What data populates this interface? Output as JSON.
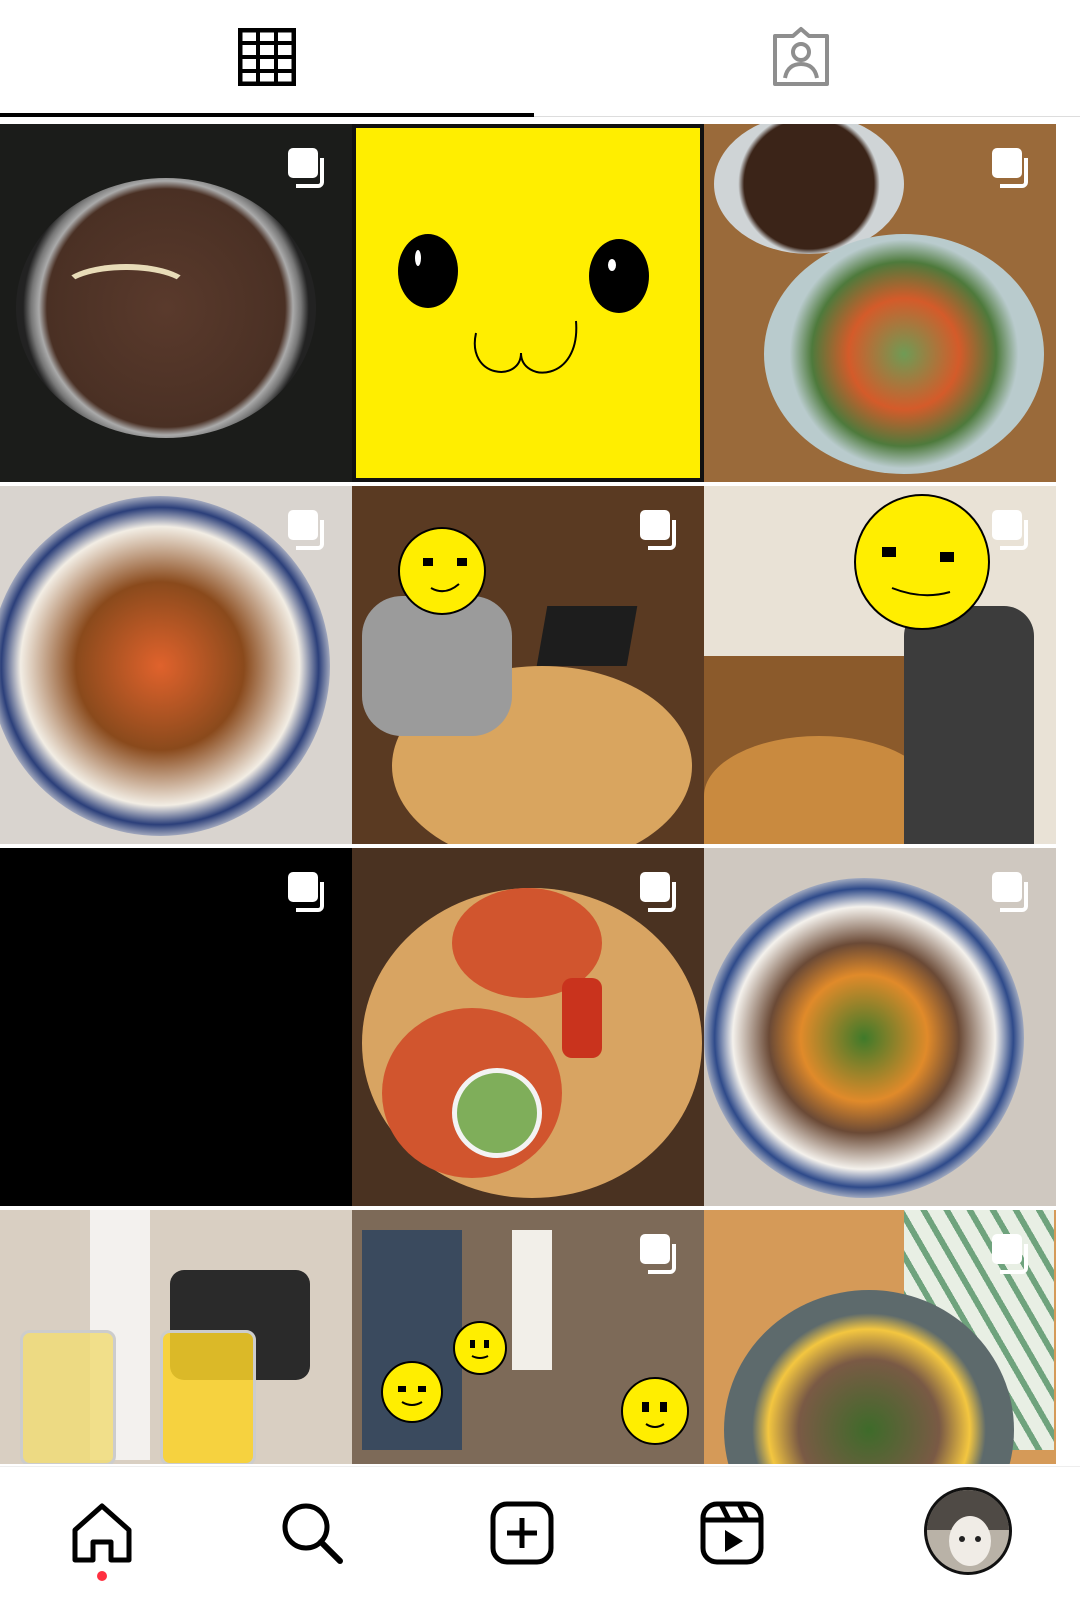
{
  "tabs": [
    {
      "name": "grid",
      "icon": "grid-icon",
      "active": true
    },
    {
      "name": "tagged",
      "icon": "tagged-person-icon",
      "active": false
    }
  ],
  "posts": [
    {
      "icon": "multi-photo-icon",
      "multiple": true
    },
    {
      "multiple": false
    },
    {
      "icon": "multi-photo-icon",
      "multiple": true
    },
    {
      "icon": "multi-photo-icon",
      "multiple": true
    },
    {
      "icon": "multi-photo-icon",
      "multiple": true
    },
    {
      "icon": "multi-photo-icon",
      "multiple": true
    },
    {
      "icon": "multi-photo-icon",
      "multiple": true
    },
    {
      "icon": "multi-photo-icon",
      "multiple": true
    },
    {
      "icon": "multi-photo-icon",
      "multiple": true
    },
    {
      "multiple": false
    },
    {
      "icon": "multi-photo-icon",
      "multiple": true
    },
    {
      "icon": "multi-photo-icon",
      "multiple": true
    }
  ],
  "bottom_nav": [
    {
      "icon": "home-icon",
      "active": true,
      "notification_dot": true
    },
    {
      "icon": "search-icon"
    },
    {
      "icon": "create-post-icon"
    },
    {
      "icon": "reels-icon"
    },
    {
      "icon": "profile-avatar"
    }
  ],
  "colors": {
    "accent_dot": "#ff3040",
    "active_tab": "#000000",
    "inactive_icon": "#8e8e8e",
    "sticker_yellow": "#ffee00"
  }
}
